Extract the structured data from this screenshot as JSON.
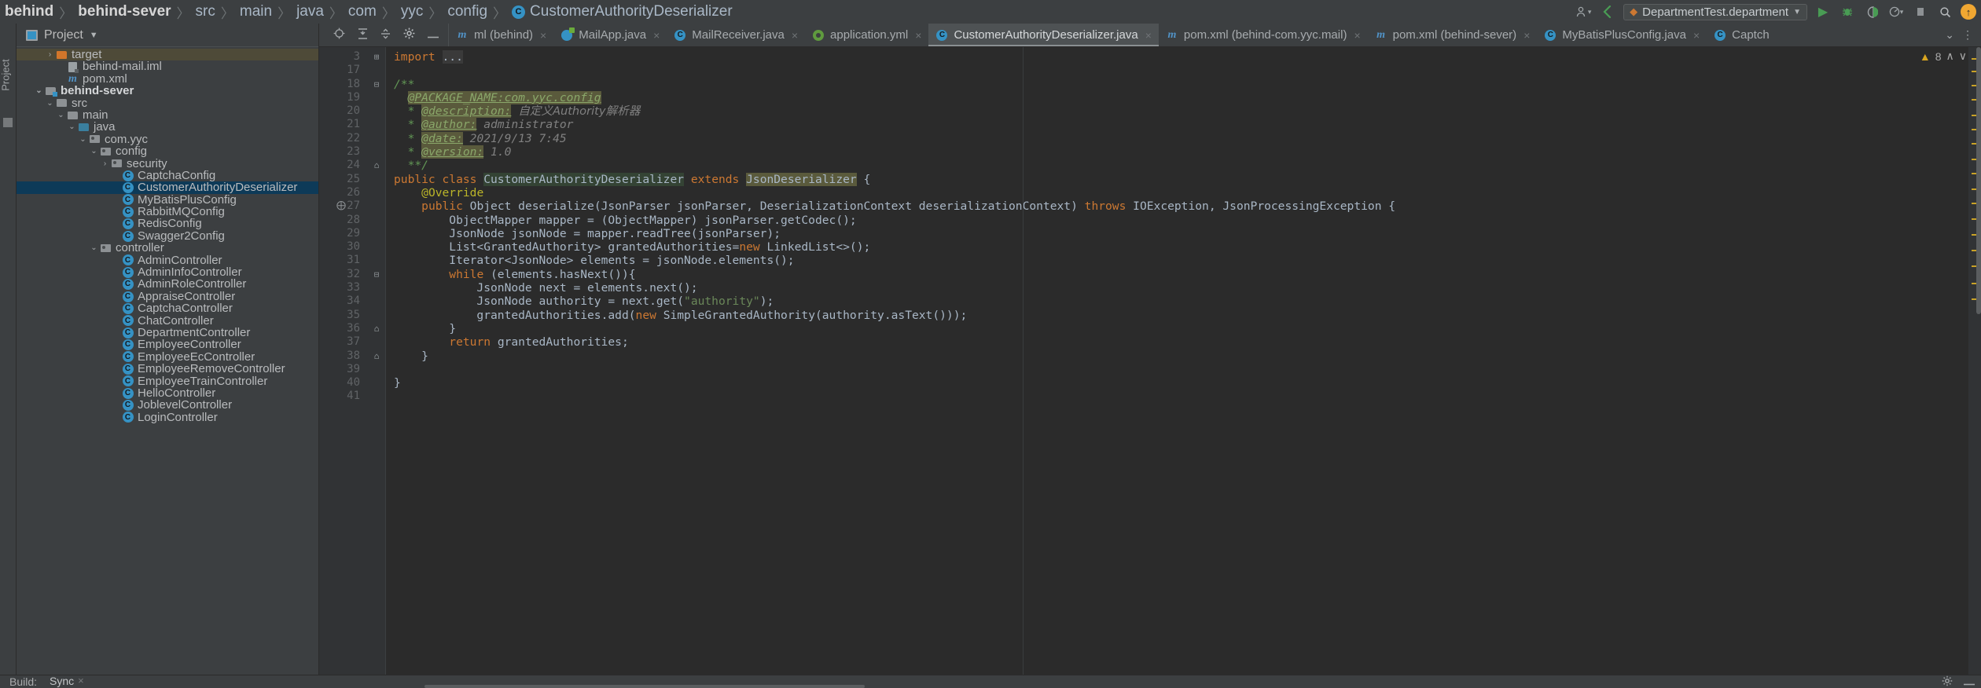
{
  "breadcrumb": {
    "items": [
      {
        "label": "behind",
        "bold": true
      },
      {
        "label": "behind-sever",
        "bold": true
      },
      {
        "label": "src",
        "bold": false
      },
      {
        "label": "main",
        "bold": false
      },
      {
        "label": "java",
        "bold": false
      },
      {
        "label": "com",
        "bold": false
      },
      {
        "label": "yyc",
        "bold": false
      },
      {
        "label": "config",
        "bold": false
      }
    ],
    "current_file": "CustomerAuthorityDeserializer",
    "separator": "〉"
  },
  "toolbar": {
    "profile_icon": "user-avatar-icon",
    "search_everywhere_icon": "search-icon",
    "run_config": "DepartmentTest.department",
    "run_icon": "run-play-icon",
    "debug_icon": "debug-bug-icon",
    "coverage_icon": "run-with-coverage-icon",
    "profiler_icon": "profiler-icon",
    "stop_icon": "stop-icon",
    "magnifier_icon": "search-icon",
    "updates_icon": "update-available-icon"
  },
  "project_panel": {
    "title": "Project",
    "vertical_label": "Project",
    "toolbar_icons": [
      "locate-icon",
      "expand-all-icon",
      "collapse-all-icon",
      "settings-gear-icon",
      "hide-icon"
    ],
    "tree": [
      {
        "label": "target",
        "indent": 2,
        "arrow": "›",
        "icon": "folder-orange",
        "state": "hover"
      },
      {
        "label": "behind-mail.iml",
        "indent": 3,
        "arrow": "",
        "icon": "iml-file"
      },
      {
        "label": "pom.xml",
        "indent": 3,
        "arrow": "",
        "icon": "maven-m"
      },
      {
        "label": "behind-sever",
        "indent": 1,
        "arrow": "⌄",
        "icon": "folder-module",
        "bold": true
      },
      {
        "label": "src",
        "indent": 2,
        "arrow": "⌄",
        "icon": "folder-gray"
      },
      {
        "label": "main",
        "indent": 3,
        "arrow": "⌄",
        "icon": "folder-gray"
      },
      {
        "label": "java",
        "indent": 4,
        "arrow": "⌄",
        "icon": "folder-source-blue"
      },
      {
        "label": "com.yyc",
        "indent": 5,
        "arrow": "⌄",
        "icon": "folder-package"
      },
      {
        "label": "config",
        "indent": 6,
        "arrow": "⌄",
        "icon": "folder-package"
      },
      {
        "label": "security",
        "indent": 7,
        "arrow": "›",
        "icon": "folder-package"
      },
      {
        "label": "CaptchaConfig",
        "indent": 8,
        "arrow": "",
        "icon": "java-class"
      },
      {
        "label": "CustomerAuthorityDeserializer",
        "indent": 8,
        "arrow": "",
        "icon": "java-class",
        "state": "selected"
      },
      {
        "label": "MyBatisPlusConfig",
        "indent": 8,
        "arrow": "",
        "icon": "java-class"
      },
      {
        "label": "RabbitMQConfig",
        "indent": 8,
        "arrow": "",
        "icon": "java-class"
      },
      {
        "label": "RedisConfig",
        "indent": 8,
        "arrow": "",
        "icon": "java-class"
      },
      {
        "label": "Swagger2Config",
        "indent": 8,
        "arrow": "",
        "icon": "java-class"
      },
      {
        "label": "controller",
        "indent": 6,
        "arrow": "⌄",
        "icon": "folder-package"
      },
      {
        "label": "AdminController",
        "indent": 8,
        "arrow": "",
        "icon": "java-class"
      },
      {
        "label": "AdminInfoController",
        "indent": 8,
        "arrow": "",
        "icon": "java-class"
      },
      {
        "label": "AdminRoleController",
        "indent": 8,
        "arrow": "",
        "icon": "java-class"
      },
      {
        "label": "AppraiseController",
        "indent": 8,
        "arrow": "",
        "icon": "java-class"
      },
      {
        "label": "CaptchaController",
        "indent": 8,
        "arrow": "",
        "icon": "java-class"
      },
      {
        "label": "ChatController",
        "indent": 8,
        "arrow": "",
        "icon": "java-class"
      },
      {
        "label": "DepartmentController",
        "indent": 8,
        "arrow": "",
        "icon": "java-class"
      },
      {
        "label": "EmployeeController",
        "indent": 8,
        "arrow": "",
        "icon": "java-class"
      },
      {
        "label": "EmployeeEcController",
        "indent": 8,
        "arrow": "",
        "icon": "java-class"
      },
      {
        "label": "EmployeeRemoveController",
        "indent": 8,
        "arrow": "",
        "icon": "java-class"
      },
      {
        "label": "EmployeeTrainController",
        "indent": 8,
        "arrow": "",
        "icon": "java-class"
      },
      {
        "label": "HelloController",
        "indent": 8,
        "arrow": "",
        "icon": "java-class"
      },
      {
        "label": "JoblevelController",
        "indent": 8,
        "arrow": "",
        "icon": "java-class"
      },
      {
        "label": "LoginController",
        "indent": 8,
        "arrow": "",
        "icon": "java-class"
      }
    ]
  },
  "editor_tabs": [
    {
      "label": "ml (behind)",
      "icon": "maven-m",
      "active": false,
      "closable": true
    },
    {
      "label": "MailApp.java",
      "icon": "spring-boot",
      "active": false,
      "closable": true
    },
    {
      "label": "MailReceiver.java",
      "icon": "java-class",
      "active": false,
      "closable": true
    },
    {
      "label": "application.yml",
      "icon": "yaml-leaf",
      "active": false,
      "closable": true
    },
    {
      "label": "CustomerAuthorityDeserializer.java",
      "icon": "java-class",
      "active": true,
      "closable": true
    },
    {
      "label": "pom.xml (behind-com.yyc.mail)",
      "icon": "maven-m",
      "active": false,
      "closable": true
    },
    {
      "label": "pom.xml (behind-sever)",
      "icon": "maven-m",
      "active": false,
      "closable": true
    },
    {
      "label": "MyBatisPlusConfig.java",
      "icon": "java-class",
      "active": false,
      "closable": true
    },
    {
      "label": "Captch",
      "icon": "java-class",
      "active": false,
      "closable": false
    }
  ],
  "editor_tabs_tail": {
    "chevron": "⌄",
    "overflow": "⋮"
  },
  "inspection": {
    "count": "8",
    "icon": "warning-triangle-icon",
    "up": "∧",
    "down": "∨"
  },
  "code": {
    "lines": [
      {
        "num": "3",
        "fold": "⊞",
        "tokens": [
          {
            "t": "import ",
            "c": "kw"
          },
          {
            "t": "...",
            "c": "id hl-dark"
          }
        ]
      },
      {
        "num": "17",
        "fold": "",
        "tokens": []
      },
      {
        "num": "18",
        "fold": "⊟",
        "tokens": [
          {
            "t": "/**",
            "c": "cmt"
          }
        ]
      },
      {
        "num": "19",
        "fold": "",
        "tokens": [
          {
            "t": "  ",
            "c": "id"
          },
          {
            "t": "@PACKAGE_NAME:com.yyc.config",
            "c": "tag"
          }
        ]
      },
      {
        "num": "20",
        "fold": "",
        "tokens": [
          {
            "t": "  * ",
            "c": "cmt"
          },
          {
            "t": "@description:",
            "c": "tag"
          },
          {
            "t": " ",
            "c": "id"
          },
          {
            "t": "自定义Authority解析器",
            "c": "cjk"
          }
        ]
      },
      {
        "num": "21",
        "fold": "",
        "tokens": [
          {
            "t": "  * ",
            "c": "cmt"
          },
          {
            "t": "@author:",
            "c": "tag"
          },
          {
            "t": " administrator",
            "c": "cmt-plain"
          }
        ]
      },
      {
        "num": "22",
        "fold": "",
        "tokens": [
          {
            "t": "  * ",
            "c": "cmt"
          },
          {
            "t": "@date:",
            "c": "tag"
          },
          {
            "t": " 2021/9/13 7:45",
            "c": "cmt-plain"
          }
        ]
      },
      {
        "num": "23",
        "fold": "",
        "tokens": [
          {
            "t": "  * ",
            "c": "cmt"
          },
          {
            "t": "@version:",
            "c": "tag"
          },
          {
            "t": " 1.0",
            "c": "cmt-plain"
          }
        ]
      },
      {
        "num": "24",
        "fold": "⌂",
        "tokens": [
          {
            "t": "  **/",
            "c": "cmt"
          }
        ]
      },
      {
        "num": "25",
        "fold": "",
        "tokens": [
          {
            "t": "public class ",
            "c": "kw"
          },
          {
            "t": "CustomerAuthorityDeserializer",
            "c": "id hl-green"
          },
          {
            "t": " extends ",
            "c": "kw"
          },
          {
            "t": "JsonDeserializer",
            "c": "id hl-olive"
          },
          {
            "t": " {",
            "c": "id"
          }
        ]
      },
      {
        "num": "26",
        "fold": "",
        "tokens": [
          {
            "t": "    ",
            "c": "id"
          },
          {
            "t": "@Override",
            "c": "anno"
          }
        ]
      },
      {
        "num": "27",
        "fold": "",
        "tokens": [
          {
            "t": "    ",
            "c": "id"
          },
          {
            "t": "public ",
            "c": "kw"
          },
          {
            "t": "Object deserialize(JsonParser jsonParser, DeserializationContext deserializationContext) ",
            "c": "id"
          },
          {
            "t": "throws ",
            "c": "kw"
          },
          {
            "t": "IOException, JsonProcessingException {",
            "c": "id"
          }
        ]
      },
      {
        "num": "28",
        "fold": "",
        "tokens": [
          {
            "t": "        ObjectMapper mapper = (ObjectMapper) jsonParser.getCodec();",
            "c": "id"
          }
        ]
      },
      {
        "num": "29",
        "fold": "",
        "tokens": [
          {
            "t": "        JsonNode jsonNode = mapper.readTree(jsonParser);",
            "c": "id"
          }
        ]
      },
      {
        "num": "30",
        "fold": "",
        "tokens": [
          {
            "t": "        List<GrantedAuthority> grantedAuthorities=",
            "c": "id"
          },
          {
            "t": "new ",
            "c": "kw"
          },
          {
            "t": "LinkedList<>();",
            "c": "id"
          }
        ]
      },
      {
        "num": "31",
        "fold": "",
        "tokens": [
          {
            "t": "        Iterator<JsonNode> elements = jsonNode.elements();",
            "c": "id"
          }
        ]
      },
      {
        "num": "32",
        "fold": "⊟",
        "tokens": [
          {
            "t": "        ",
            "c": "id"
          },
          {
            "t": "while ",
            "c": "kw"
          },
          {
            "t": "(elements.hasNext()){",
            "c": "id"
          }
        ]
      },
      {
        "num": "33",
        "fold": "",
        "tokens": [
          {
            "t": "            JsonNode next = elements.next();",
            "c": "id"
          }
        ]
      },
      {
        "num": "34",
        "fold": "",
        "tokens": [
          {
            "t": "            JsonNode authority = next.get(",
            "c": "id"
          },
          {
            "t": "\"authority\"",
            "c": "str"
          },
          {
            "t": ");",
            "c": "id"
          }
        ]
      },
      {
        "num": "35",
        "fold": "",
        "tokens": [
          {
            "t": "            grantedAuthorities.add(",
            "c": "id"
          },
          {
            "t": "new ",
            "c": "kw"
          },
          {
            "t": "SimpleGrantedAuthority(authority.asText()));",
            "c": "id"
          }
        ]
      },
      {
        "num": "36",
        "fold": "⌂",
        "tokens": [
          {
            "t": "        }",
            "c": "id"
          }
        ]
      },
      {
        "num": "37",
        "fold": "",
        "tokens": [
          {
            "t": "        ",
            "c": "id"
          },
          {
            "t": "return ",
            "c": "kw"
          },
          {
            "t": "grantedAuthorities;",
            "c": "id"
          }
        ]
      },
      {
        "num": "38",
        "fold": "⌂",
        "tokens": [
          {
            "t": "    }",
            "c": "id"
          }
        ]
      },
      {
        "num": "39",
        "fold": "",
        "tokens": []
      },
      {
        "num": "40",
        "fold": "",
        "tokens": [
          {
            "t": "}",
            "c": "id"
          }
        ]
      },
      {
        "num": "41",
        "fold": "",
        "tokens": []
      }
    ],
    "gutter_markers": [
      {
        "line_index": 11,
        "glyph": "⨁",
        "name": "override-method-marker"
      }
    ]
  },
  "status_bar": {
    "build_label": "Build:",
    "sync_tab": "Sync",
    "sync_close": "×",
    "settings_icon": "gear-icon",
    "hide_icon": "minimize-icon"
  }
}
